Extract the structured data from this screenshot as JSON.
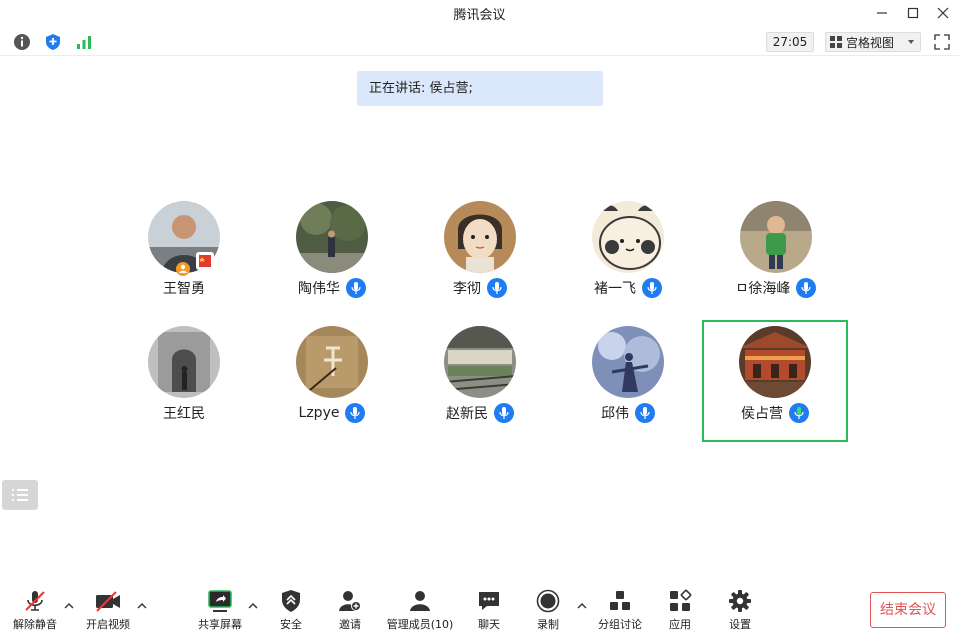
{
  "window": {
    "title": "腾讯会议"
  },
  "infobar": {
    "timer": "27:05",
    "view_label": "宫格视图"
  },
  "speaking": {
    "text": "正在讲话: 侯占营;"
  },
  "participants": [
    {
      "name": "王智勇"
    },
    {
      "name": "陶伟华"
    },
    {
      "name": "李彻"
    },
    {
      "name": "褚一飞"
    },
    {
      "name": "ㅁ徐海峰"
    },
    {
      "name": "王红民"
    },
    {
      "name": "Lzpye"
    },
    {
      "name": "赵新民"
    },
    {
      "name": "邱伟"
    },
    {
      "name": "侯占营"
    }
  ],
  "toolbar": {
    "unmute": "解除静音",
    "start_video": "开启视频",
    "share_screen": "共享屏幕",
    "security": "安全",
    "invite": "邀请",
    "manage_members": "管理成员(10)",
    "chat": "聊天",
    "record": "录制",
    "breakout": "分组讨论",
    "apps": "应用",
    "settings": "设置",
    "end_meeting": "结束会议"
  },
  "colors": {
    "accent_blue": "#1f7cf2",
    "active_green": "#2bbb5a",
    "danger_red": "#e35454",
    "banner_bg": "#dbe8fb"
  }
}
